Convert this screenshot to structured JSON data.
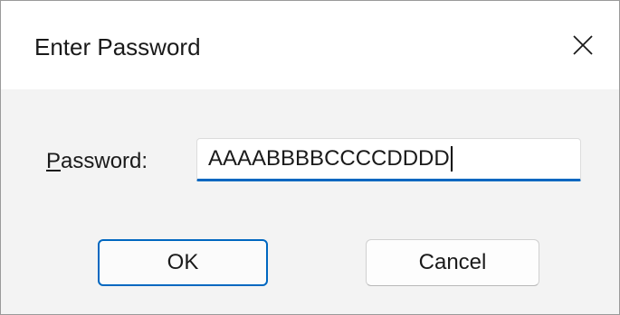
{
  "dialog": {
    "title": "Enter Password",
    "close_icon": "close-icon"
  },
  "form": {
    "password_label_accesskey": "P",
    "password_label_rest": "assword:",
    "password_value": "AAAABBBBCCCCDDDD"
  },
  "buttons": {
    "ok_label": "OK",
    "cancel_label": "Cancel"
  },
  "colors": {
    "accent": "#0067c0",
    "dialog_bg": "#f3f3f3",
    "title_bg": "#ffffff"
  }
}
